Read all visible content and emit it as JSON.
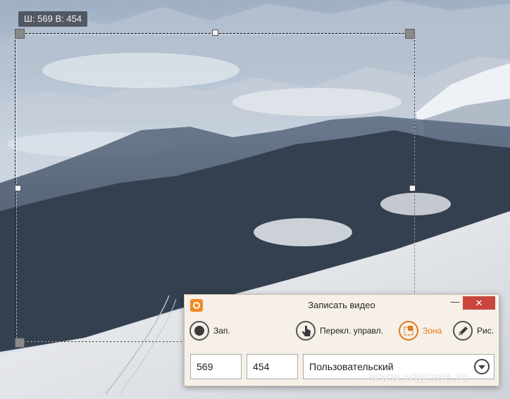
{
  "overlay": {
    "size_label": "Ш: 569 В: 454"
  },
  "recorder": {
    "title": "Записать видео",
    "min_label": "—",
    "close_label": "✕",
    "tools": {
      "record_label": "Зап.",
      "switch_label": "Перекл. управл.",
      "zone_label": "Зона",
      "draw_label": "Рис."
    },
    "width_value": "569",
    "height_value": "454",
    "preset_value": "Пользовательский"
  },
  "watermark": "www.wincore.ru",
  "colors": {
    "accent": "#e07a1a",
    "close": "#c9463d",
    "window_bg": "#f6f0e8"
  },
  "icons": {
    "app": "camera-record-icon",
    "record": "record-icon",
    "switch": "hand-pointer-icon",
    "zone": "zone-select-icon",
    "draw": "pencil-icon",
    "dropdown": "chevron-down-icon"
  }
}
